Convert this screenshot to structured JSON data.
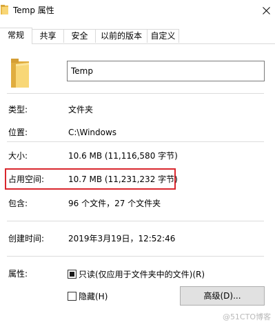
{
  "window": {
    "title": "Temp 属性",
    "close_icon": "close-icon"
  },
  "tabs": [
    {
      "label": "常规",
      "active": true
    },
    {
      "label": "共享",
      "active": false
    },
    {
      "label": "安全",
      "active": false
    },
    {
      "label": "以前的版本",
      "active": false
    },
    {
      "label": "自定义",
      "active": false
    }
  ],
  "general": {
    "folder_icon": "folder-icon",
    "name_value": "Temp",
    "rows": {
      "type": {
        "label": "类型:",
        "value": "文件夹"
      },
      "location": {
        "label": "位置:",
        "value": "C:\\Windows"
      },
      "size": {
        "label": "大小:",
        "value": "10.6 MB (11,116,580 字节)"
      },
      "size_on_disk": {
        "label": "占用空间:",
        "value": "10.7 MB (11,231,232 字节)"
      },
      "contains": {
        "label": "包含:",
        "value": "96 个文件，27 个文件夹"
      },
      "created": {
        "label": "创建时间:",
        "value": "2019年3月19日，12:52:46"
      }
    },
    "attributes": {
      "label": "属性:",
      "readonly_label": "只读(仅应用于文件夹中的文件)(R)",
      "readonly_state": "indeterminate",
      "hidden_label": "隐藏(H)",
      "hidden_checked": false,
      "advanced_button": "高级(D)..."
    }
  },
  "annotation": {
    "highlight_color": "#d9262d"
  },
  "watermark": "@51CTO博客"
}
